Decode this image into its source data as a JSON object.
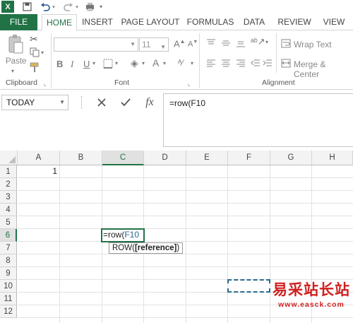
{
  "ribbon_tabs": [
    "FILE",
    "HOME",
    "INSERT",
    "PAGE LAYOUT",
    "FORMULAS",
    "DATA",
    "REVIEW",
    "VIEW"
  ],
  "active_tab": "HOME",
  "ribbon": {
    "clipboard": {
      "paste_label": "Paste",
      "group_label": "Clipboard"
    },
    "font": {
      "font_size": "11",
      "group_label": "Font",
      "bold": "B",
      "italic": "I",
      "underline": "U"
    },
    "alignment": {
      "wrap_text": "Wrap Text",
      "merge_center": "Merge & Center",
      "group_label": "Alignment"
    }
  },
  "name_box": "TODAY",
  "formula_bar": {
    "fx": "fx",
    "content": "=row(F10"
  },
  "columns": [
    "A",
    "B",
    "C",
    "D",
    "E",
    "F",
    "G",
    "H"
  ],
  "selected_column": "C",
  "rows": [
    "1",
    "2",
    "3",
    "4",
    "5",
    "6",
    "7",
    "8",
    "9",
    "10",
    "11",
    "12"
  ],
  "selected_row": "6",
  "cells": {
    "A1": "1"
  },
  "active_cell": {
    "prefix": "=row(",
    "ref": "F10"
  },
  "tooltip": {
    "func": "ROW(",
    "arg": "[reference]",
    "close": ")"
  },
  "watermark": {
    "text": "易采站长站",
    "url": "www.easck.com"
  },
  "colors": {
    "excel_green": "#217346",
    "ref_blue": "#2a6c8f",
    "watermark_red": "#d02020"
  }
}
